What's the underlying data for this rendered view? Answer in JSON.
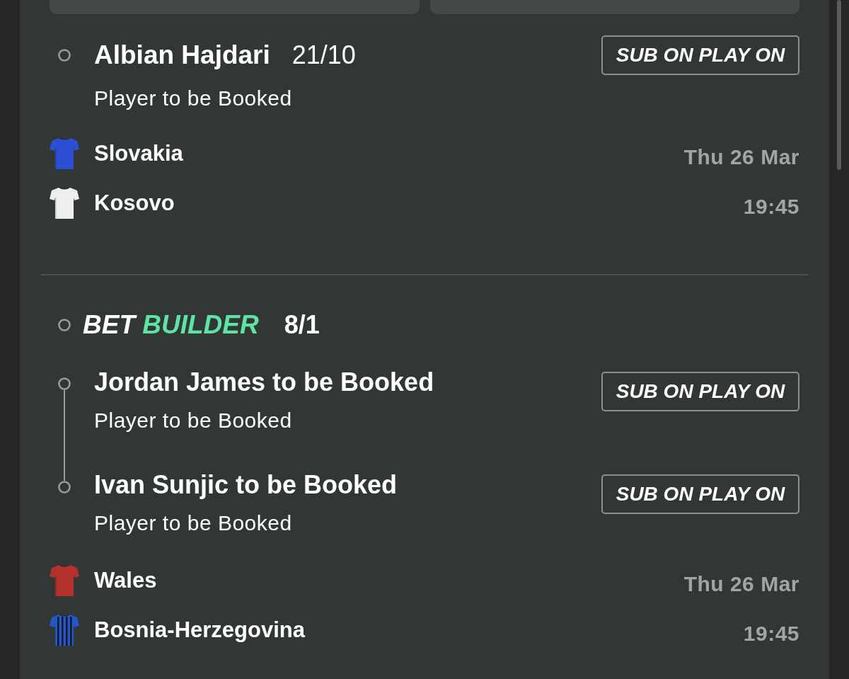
{
  "selections": [
    {
      "kind": "single",
      "title": "Albian Hajdari",
      "odds": "21/10",
      "market": "Player to be Booked",
      "button": "SUB ON PLAY ON",
      "match": {
        "teams": [
          {
            "name": "Slovakia",
            "kind": "plain",
            "color": "#2c4fd4"
          },
          {
            "name": "Kosovo",
            "kind": "plain",
            "color": "#eeeeee"
          }
        ],
        "date": "Thu 26 Mar",
        "time": "19:45"
      }
    },
    {
      "kind": "bet_builder",
      "title": "BET",
      "title_accent": "BUILDER",
      "odds": "8/1",
      "legs": [
        {
          "title": "Jordan James to be Booked",
          "market": "Player to be Booked",
          "button": "SUB ON PLAY ON"
        },
        {
          "title": "Ivan Sunjic to be Booked",
          "market": "Player to be Booked",
          "button": "SUB ON PLAY ON"
        }
      ],
      "match": {
        "teams": [
          {
            "name": "Wales",
            "kind": "plain",
            "color": "#b4302b"
          },
          {
            "name": "Bosnia-Herzegovina",
            "kind": "striped",
            "color": "#2357c9"
          }
        ],
        "date": "Thu 26 Mar",
        "time": "19:45"
      }
    }
  ]
}
